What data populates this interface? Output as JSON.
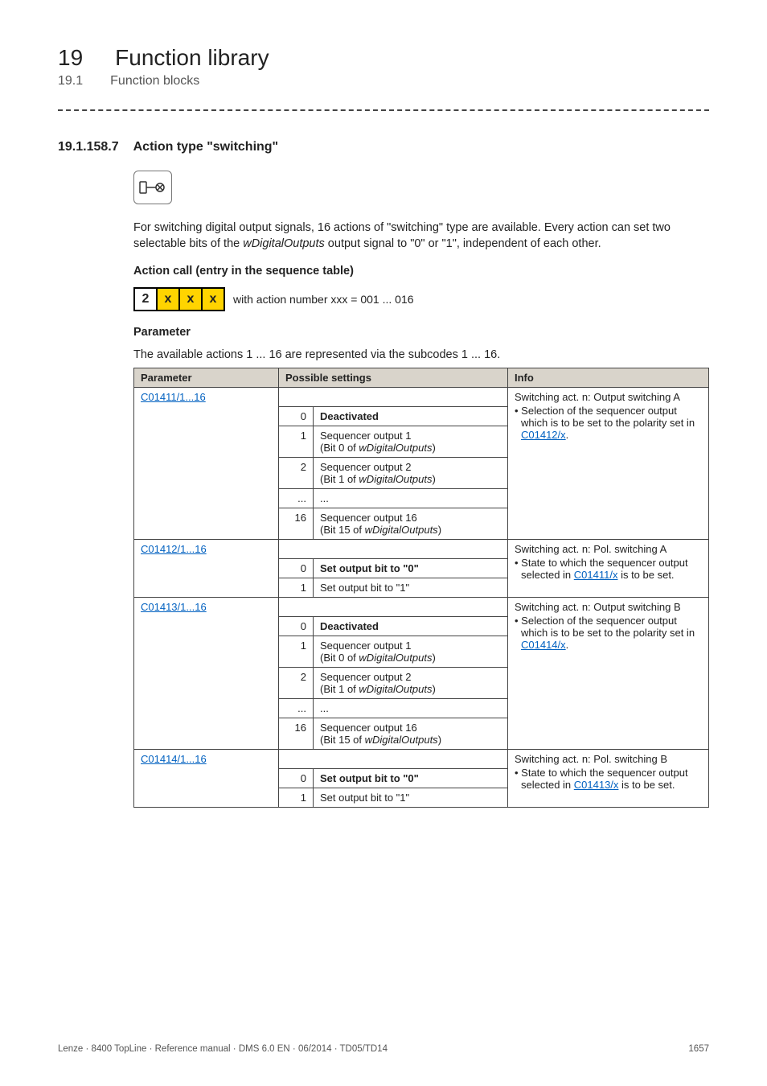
{
  "chapter": {
    "number": "19",
    "title": "Function library"
  },
  "section": {
    "number": "19.1",
    "title": "Function blocks"
  },
  "heading": {
    "number": "19.1.158.7",
    "title": "Action type \"switching\""
  },
  "intro_para_pre": "For switching digital output signals, 16 actions of \"switching\" type are available. Every action can set two selectable bits of the ",
  "intro_para_em": "wDigitalOutputs",
  "intro_para_post": " output signal to \"0\" or \"1\", independent of each other.",
  "sub_action_call": "Action call (entry in the sequence table)",
  "action_cells": [
    "2",
    "x",
    "x",
    "x"
  ],
  "action_label": " with action number xxx = 001 ... 016",
  "sub_parameter": "Parameter",
  "param_intro": "The available actions 1 ... 16 are represented via the subcodes 1 ... 16.",
  "table_headers": {
    "param": "Parameter",
    "settings": "Possible settings",
    "info": "Info"
  },
  "groups": [
    {
      "code": "C01411/1...16",
      "info_lead": "Switching act. n: Output switching A",
      "info_bullet_pre": "• Selection of the sequencer output which is to be set to the polarity set in ",
      "info_link": "C01412/x",
      "info_bullet_post": ".",
      "rows": [
        {
          "n": "0",
          "text": "Deactivated",
          "bold": true
        },
        {
          "n": "1",
          "pre": "Sequencer output 1",
          "sub_pre": "(Bit 0 of ",
          "sub_em": "wDigitalOutputs",
          "sub_post": ")"
        },
        {
          "n": "2",
          "pre": "Sequencer output 2",
          "sub_pre": "(Bit 1 of ",
          "sub_em": "wDigitalOutputs",
          "sub_post": ")"
        },
        {
          "n": "...",
          "text": "..."
        },
        {
          "n": "16",
          "pre": "Sequencer output 16",
          "sub_pre": "(Bit 15 of ",
          "sub_em": "wDigitalOutputs",
          "sub_post": ")"
        }
      ]
    },
    {
      "code": "C01412/1...16",
      "info_lead": "Switching act. n: Pol. switching A",
      "info_bullet_pre": "• State to which the sequencer output selected in ",
      "info_link": "C01411/x",
      "info_bullet_post": " is to be set.",
      "rows": [
        {
          "n": "0",
          "text": "Set output bit to \"0\"",
          "bold": true
        },
        {
          "n": "1",
          "text": "Set output bit to \"1\""
        }
      ]
    },
    {
      "code": "C01413/1...16",
      "info_lead": "Switching act. n: Output switching B",
      "info_bullet_pre": "• Selection of the sequencer output which is to be set to the polarity set in ",
      "info_link": "C01414/x",
      "info_bullet_post": ".",
      "rows": [
        {
          "n": "0",
          "text": "Deactivated",
          "bold": true
        },
        {
          "n": "1",
          "pre": "Sequencer output 1",
          "sub_pre": "(Bit 0 of ",
          "sub_em": "wDigitalOutputs",
          "sub_post": ")"
        },
        {
          "n": "2",
          "pre": "Sequencer output 2",
          "sub_pre": "(Bit 1 of ",
          "sub_em": "wDigitalOutputs",
          "sub_post": ")"
        },
        {
          "n": "...",
          "text": "..."
        },
        {
          "n": "16",
          "pre": "Sequencer output 16",
          "sub_pre": "(Bit 15 of ",
          "sub_em": "wDigitalOutputs",
          "sub_post": ")"
        }
      ]
    },
    {
      "code": "C01414/1...16",
      "info_lead": "Switching act. n: Pol. switching B",
      "info_bullet_pre": "• State to which the sequencer output selected in ",
      "info_link": "C01413/x",
      "info_bullet_post": " is to be set.",
      "rows": [
        {
          "n": "0",
          "text": "Set output bit to \"0\"",
          "bold": true
        },
        {
          "n": "1",
          "text": "Set output bit to \"1\""
        }
      ]
    }
  ],
  "footer_left": "Lenze · 8400 TopLine · Reference manual · DMS 6.0 EN · 06/2014 · TD05/TD14",
  "footer_right": "1657"
}
